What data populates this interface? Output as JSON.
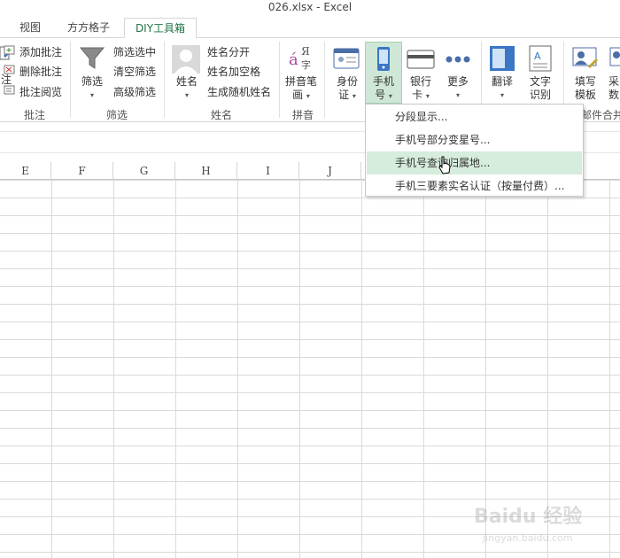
{
  "window": {
    "title": "026.xlsx - Excel"
  },
  "tabs": [
    {
      "label": "视图"
    },
    {
      "label": "方方格子"
    },
    {
      "label": "DIY工具箱"
    }
  ],
  "ribbon": {
    "groups": {
      "comment": {
        "label": "批注",
        "big_button": "注",
        "items": [
          "添加批注",
          "删除批注",
          "批注阅览"
        ]
      },
      "filter": {
        "label": "筛选",
        "big_button": "筛选",
        "items": [
          "筛选选中",
          "清空筛选",
          "高级筛选"
        ]
      },
      "name": {
        "label": "姓名",
        "big_button": "姓名",
        "items": [
          "姓名分开",
          "姓名加空格",
          "生成随机姓名"
        ]
      },
      "pinyin": {
        "label": "拼音",
        "big_button_line1": "拼音笔",
        "big_button_line2": "画",
        "icon_text": "á",
        "icon_text2": "Я",
        "icon_text3": "字"
      },
      "id_tools": {
        "buttons": [
          {
            "line1": "身份",
            "line2": "证"
          },
          {
            "line1": "手机",
            "line2": "号"
          },
          {
            "line1": "银行",
            "line2": "卡"
          },
          {
            "line1": "更多",
            "line2": ""
          }
        ]
      },
      "translate": {
        "buttons": [
          {
            "line1": "翻译",
            "line2": ""
          },
          {
            "line1": "文字",
            "line2": "识别"
          }
        ]
      },
      "mail": {
        "label": "邮件合并",
        "buttons": [
          {
            "line1": "填写",
            "line2": "模板"
          },
          {
            "line1": "采",
            "line2": "数"
          }
        ]
      }
    }
  },
  "phone_menu": {
    "items": [
      {
        "label": "分段显示..."
      },
      {
        "label": "手机号部分变星号..."
      },
      {
        "label": "手机号查询归属地..."
      },
      {
        "label": "手机三要素实名认证（按量付费）..."
      }
    ],
    "hovered_index": 2
  },
  "sheet": {
    "columns": [
      "E",
      "F",
      "G",
      "H",
      "I",
      "J"
    ]
  },
  "watermark": {
    "text": "Baidu 经验",
    "sub": "jingyan.baidu.com"
  }
}
